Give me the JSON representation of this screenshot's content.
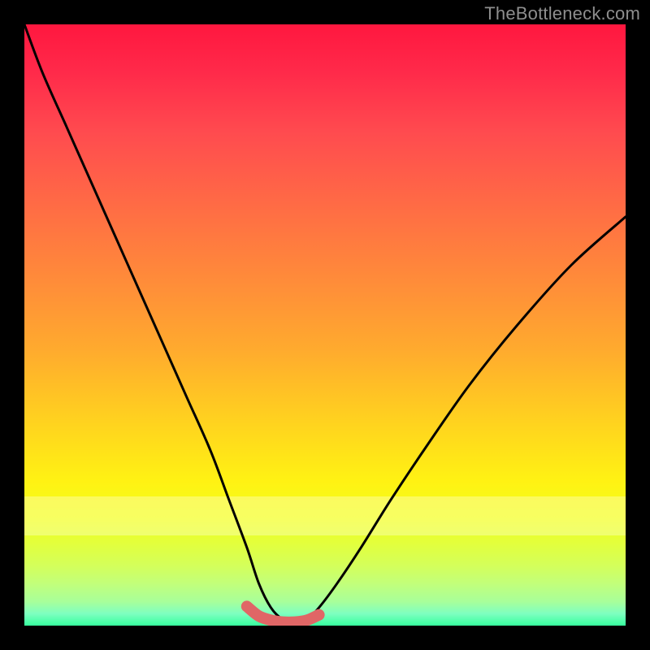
{
  "watermark": "TheBottleneck.com",
  "colors": {
    "page_bg": "#000000",
    "curve": "#000000",
    "highlight": "#e06666",
    "gradient_stops": [
      "#ff173f",
      "#ff2a4a",
      "#ff4b4f",
      "#ff6b45",
      "#ff8a3a",
      "#ffaa2e",
      "#ffd21f",
      "#fff213",
      "#f3ff1a",
      "#e4ff3a",
      "#d4ff5a",
      "#c2ff7a",
      "#a8ff9a",
      "#7effc0",
      "#37ff9e"
    ]
  },
  "chart_data": {
    "type": "line",
    "title": "",
    "xlabel": "",
    "ylabel": "",
    "xlim": [
      0,
      100
    ],
    "ylim": [
      0,
      100
    ],
    "note": "Axes are implicit (no tick labels shown). Values are read as percent of plot width/height with (0,0) at bottom-left. The curve is a V/valley shape that reaches ~0 near x≈40–48 and rises steeply to both sides; a thick salmon highlight marks the flat valley bottom.",
    "series": [
      {
        "name": "bottleneck-curve",
        "x": [
          0,
          3,
          7,
          11,
          15,
          19,
          23,
          27,
          31,
          34,
          37,
          39,
          41,
          43,
          45,
          47,
          49,
          52,
          56,
          61,
          67,
          74,
          82,
          91,
          100
        ],
        "y": [
          100,
          92,
          83,
          74,
          65,
          56,
          47,
          38,
          29,
          21,
          13,
          7,
          3,
          1,
          0.5,
          1,
          3,
          7,
          13,
          21,
          30,
          40,
          50,
          60,
          68
        ]
      }
    ],
    "highlight": {
      "name": "valley-bottom",
      "x": [
        37,
        39,
        41,
        43,
        45,
        47,
        49
      ],
      "y": [
        3.2,
        1.6,
        0.9,
        0.6,
        0.6,
        0.9,
        1.8
      ]
    }
  }
}
